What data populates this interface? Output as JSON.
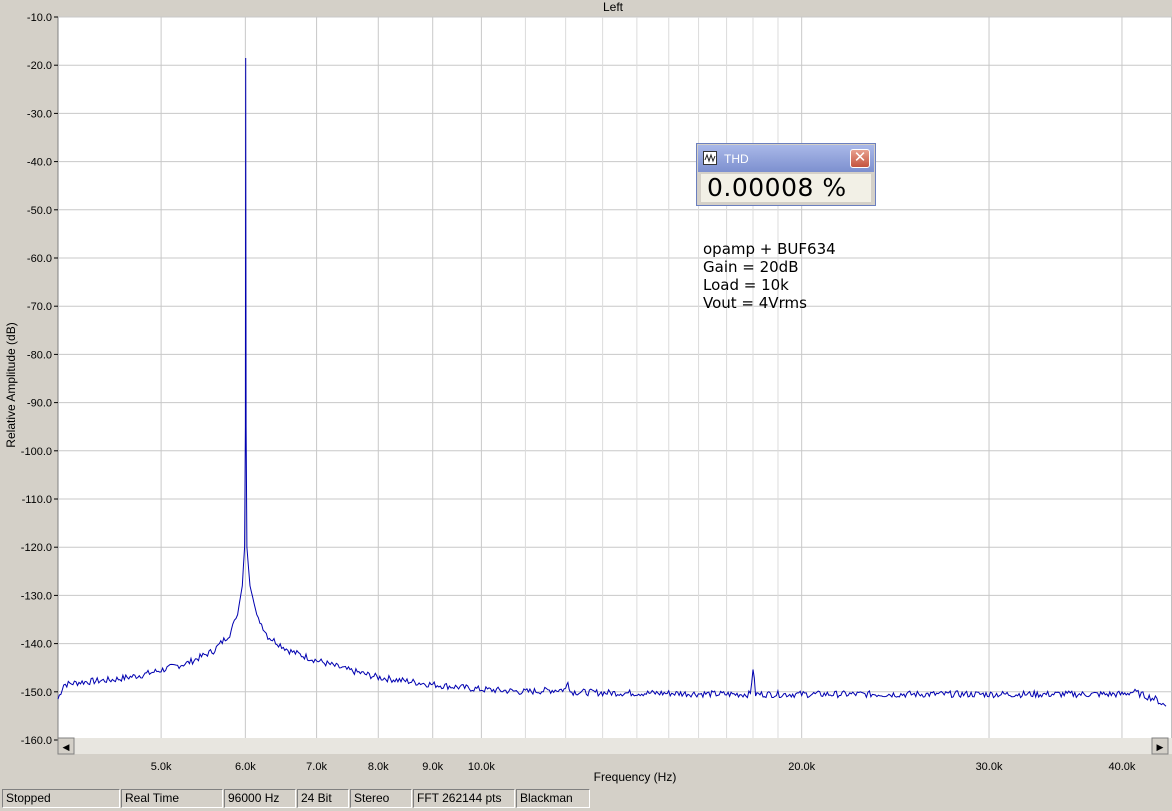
{
  "chart_data": {
    "type": "line",
    "title": "Left",
    "xlabel": "Frequency (Hz)",
    "ylabel": "Relative Amplitude (dB)",
    "x_scale": "log",
    "xlim": [
      4000,
      44000
    ],
    "ylim": [
      -160,
      -10
    ],
    "grid": true,
    "y_ticks": [
      "-10.0",
      "-20.0",
      "-30.0",
      "-40.0",
      "-50.0",
      "-60.0",
      "-70.0",
      "-80.0",
      "-90.0",
      "-100.0",
      "-110.0",
      "-120.0",
      "-130.0",
      "-140.0",
      "-150.0",
      "-160.0"
    ],
    "x_ticks": [
      {
        "value": 5000,
        "label": "5.0k"
      },
      {
        "value": 6000,
        "label": "6.0k"
      },
      {
        "value": 7000,
        "label": "7.0k"
      },
      {
        "value": 8000,
        "label": "8.0k"
      },
      {
        "value": 9000,
        "label": "9.0k"
      },
      {
        "value": 10000,
        "label": "10.0k"
      },
      {
        "value": 20000,
        "label": "20.0k"
      },
      {
        "value": 30000,
        "label": "30.0k"
      },
      {
        "value": 40000,
        "label": "40.0k"
      }
    ],
    "x_minor_grid": [
      11000,
      12000,
      13000,
      14000,
      15000,
      16000,
      17000,
      18000,
      19000
    ],
    "series": [
      {
        "color": "#0000b0",
        "points": [
          [
            4000,
            -151.5
          ],
          [
            4050,
            -148.5
          ],
          [
            4200,
            -148.0
          ],
          [
            4500,
            -147.5
          ],
          [
            4800,
            -146.5
          ],
          [
            5000,
            -145.5
          ],
          [
            5300,
            -144.0
          ],
          [
            5600,
            -141.5
          ],
          [
            5800,
            -138.0
          ],
          [
            5900,
            -134.0
          ],
          [
            5960,
            -128.0
          ],
          [
            5990,
            -120.0
          ],
          [
            6000,
            -95.0
          ],
          [
            6005,
            -18.5
          ],
          [
            6010,
            -95.0
          ],
          [
            6020,
            -120.0
          ],
          [
            6060,
            -128.0
          ],
          [
            6150,
            -134.0
          ],
          [
            6300,
            -138.5
          ],
          [
            6600,
            -141.5
          ],
          [
            7000,
            -143.5
          ],
          [
            7500,
            -145.5
          ],
          [
            8000,
            -147.0
          ],
          [
            9000,
            -148.5
          ],
          [
            10000,
            -149.5
          ],
          [
            11000,
            -150.0
          ],
          [
            12000,
            -149.5
          ],
          [
            12060,
            -147.5
          ],
          [
            12120,
            -150.0
          ],
          [
            13000,
            -150.2
          ],
          [
            15000,
            -150.3
          ],
          [
            17000,
            -150.5
          ],
          [
            17900,
            -150.5
          ],
          [
            18000,
            -145.0
          ],
          [
            18100,
            -150.5
          ],
          [
            20000,
            -150.5
          ],
          [
            24000,
            -150.5
          ],
          [
            30000,
            -150.5
          ],
          [
            36000,
            -150.5
          ],
          [
            40000,
            -150.5
          ],
          [
            41000,
            -150.0
          ],
          [
            42000,
            -150.8
          ],
          [
            43000,
            -151.5
          ],
          [
            44000,
            -153.0
          ]
        ]
      }
    ]
  },
  "thd_window": {
    "title": "THD",
    "value": "0.00008 %",
    "close_glyph": "✕"
  },
  "annotation": {
    "lines": [
      "opamp + BUF634",
      "Gain = 20dB",
      "Load = 10k",
      "Vout = 4Vrms"
    ]
  },
  "scrollbar": {
    "left_arrow": "◀",
    "right_arrow": "▶"
  },
  "statusbar": {
    "cells": [
      "Stopped",
      "Real Time",
      "96000 Hz",
      "24 Bit",
      "Stereo",
      "FFT 262144 pts",
      "Blackman"
    ]
  }
}
